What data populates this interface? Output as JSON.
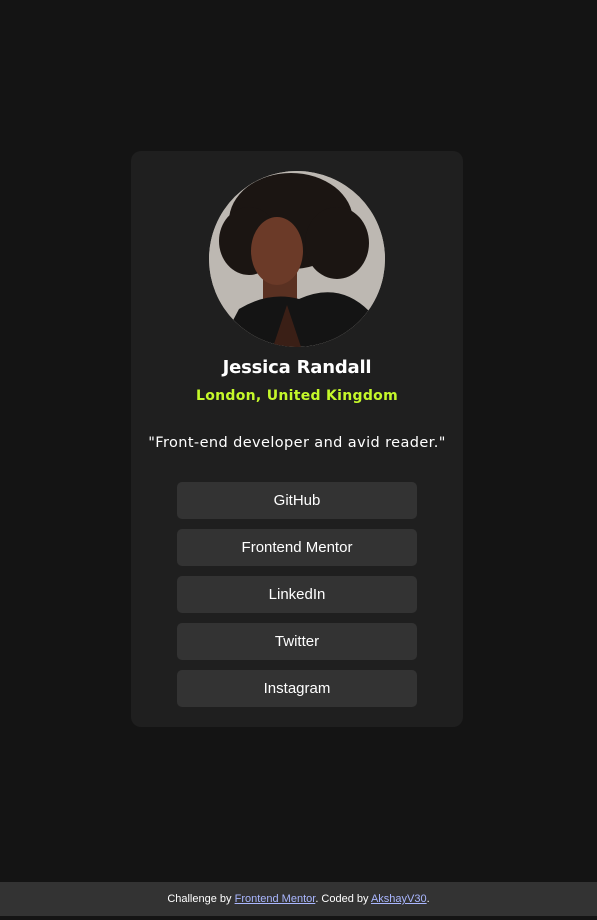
{
  "profile": {
    "name": "Jessica Randall",
    "location": "London, United Kingdom",
    "bio": "\"Front-end developer and avid reader.\""
  },
  "links": [
    {
      "label": "GitHub"
    },
    {
      "label": "Frontend Mentor"
    },
    {
      "label": "LinkedIn"
    },
    {
      "label": "Twitter"
    },
    {
      "label": "Instagram"
    }
  ],
  "footer": {
    "prefix": "Challenge by ",
    "challenge_link": "Frontend Mentor",
    "middle": ". Coded by ",
    "author_link": "AkshayV30",
    "suffix": "."
  },
  "colors": {
    "background": "#141414",
    "card": "#1f1f1f",
    "button": "#333333",
    "accent": "#c4f82a",
    "footer": "#333333",
    "footer_link": "#aab7ff"
  }
}
